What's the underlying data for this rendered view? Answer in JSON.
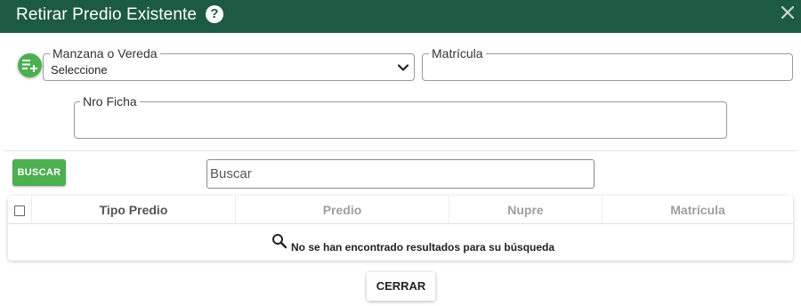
{
  "dialog": {
    "title": "Retirar Predio Existente",
    "help_icon": "?",
    "close_icon": "close-icon"
  },
  "form": {
    "manzana_label": "Manzana o Vereda",
    "manzana_value": "Seleccione",
    "matricula_label": "Matrícula",
    "matricula_value": "",
    "ficha_label": "Nro Ficha",
    "ficha_value": ""
  },
  "search": {
    "button_label": "BUSCAR",
    "placeholder": "Buscar"
  },
  "table": {
    "columns": [
      "Tipo Predio",
      "Predio",
      "Nupre",
      "Matrícula"
    ],
    "empty_message": "No se han encontrado resultados para su búsqueda"
  },
  "footer": {
    "close_label": "CERRAR"
  },
  "colors": {
    "header_bg": "#1c5a43",
    "accent_green": "#4caf50"
  }
}
